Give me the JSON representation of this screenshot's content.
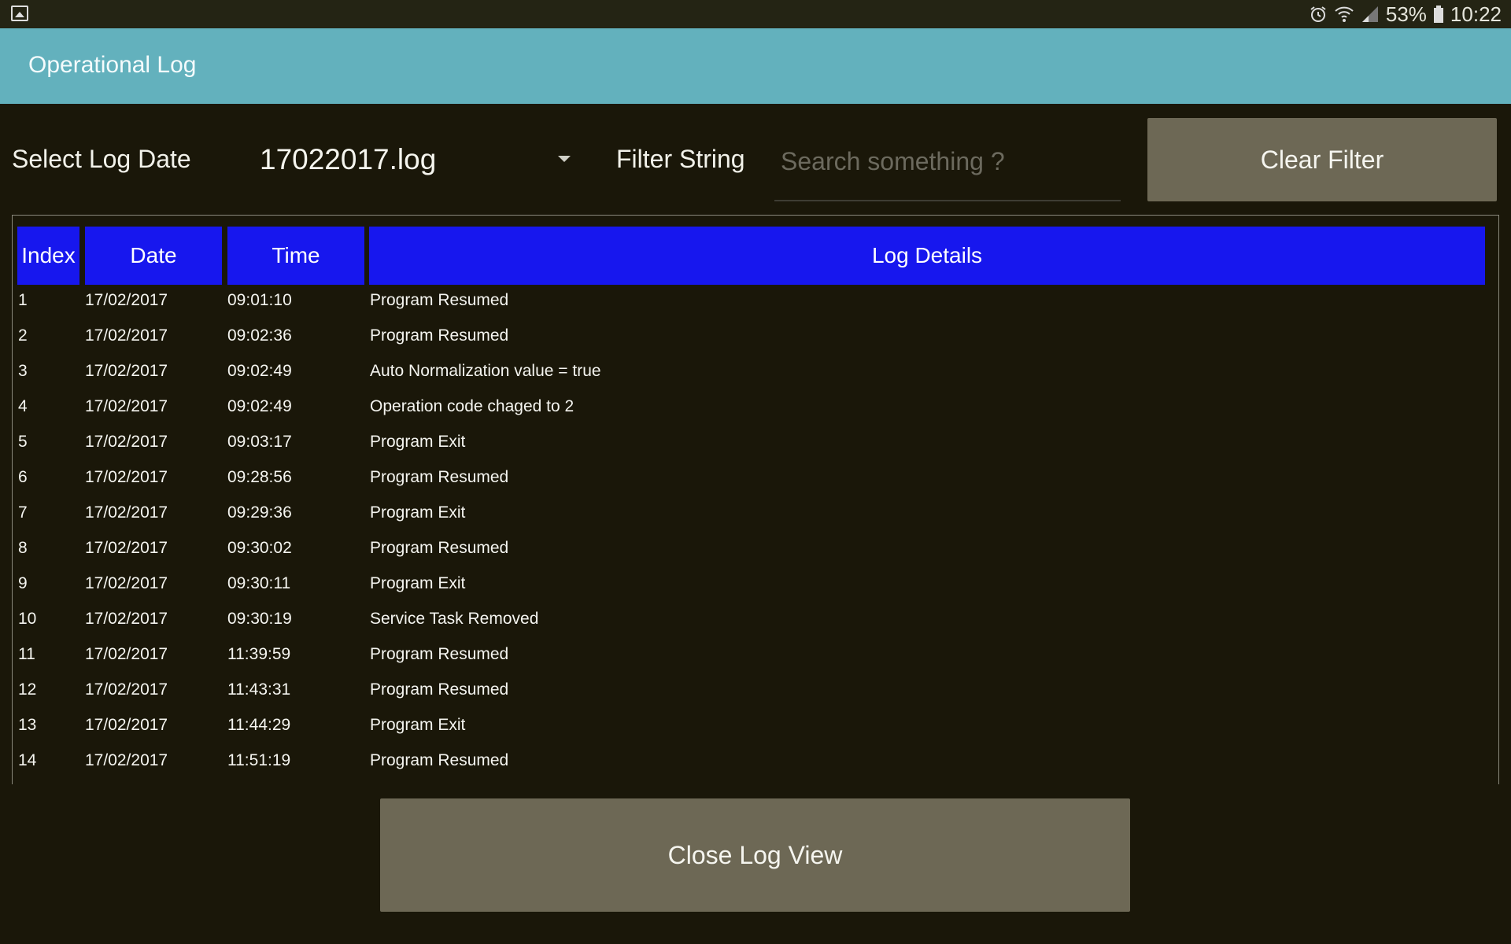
{
  "status_bar": {
    "left_icon": "gallery-icon",
    "icons": [
      "alarm-icon",
      "wifi-icon",
      "signal-icon"
    ],
    "battery_percent": "53%",
    "time": "10:22"
  },
  "app_bar": {
    "title": "Operational Log"
  },
  "controls": {
    "date_label": "Select Log Date",
    "date_selected": "17022017.log",
    "filter_label": "Filter String",
    "search_placeholder": "Search something ?",
    "search_value": "",
    "clear_button": "Clear Filter"
  },
  "table": {
    "headers": {
      "index": "Index",
      "date": "Date",
      "time": "Time",
      "details": "Log Details"
    },
    "rows": [
      {
        "index": "1",
        "date": "17/02/2017",
        "time": "09:01:10",
        "details": "Program Resumed"
      },
      {
        "index": "2",
        "date": "17/02/2017",
        "time": "09:02:36",
        "details": "Program Resumed"
      },
      {
        "index": "3",
        "date": "17/02/2017",
        "time": "09:02:49",
        "details": "Auto Normalization value = true"
      },
      {
        "index": "4",
        "date": "17/02/2017",
        "time": "09:02:49",
        "details": "Operation code chaged to 2"
      },
      {
        "index": "5",
        "date": "17/02/2017",
        "time": "09:03:17",
        "details": "Program Exit"
      },
      {
        "index": "6",
        "date": "17/02/2017",
        "time": "09:28:56",
        "details": "Program Resumed"
      },
      {
        "index": "7",
        "date": "17/02/2017",
        "time": "09:29:36",
        "details": "Program Exit"
      },
      {
        "index": "8",
        "date": "17/02/2017",
        "time": "09:30:02",
        "details": "Program Resumed"
      },
      {
        "index": "9",
        "date": "17/02/2017",
        "time": "09:30:11",
        "details": "Program Exit"
      },
      {
        "index": "10",
        "date": "17/02/2017",
        "time": "09:30:19",
        "details": "Service Task Removed"
      },
      {
        "index": "11",
        "date": "17/02/2017",
        "time": "11:39:59",
        "details": "Program Resumed"
      },
      {
        "index": "12",
        "date": "17/02/2017",
        "time": "11:43:31",
        "details": "Program Resumed"
      },
      {
        "index": "13",
        "date": "17/02/2017",
        "time": "11:44:29",
        "details": "Program Exit"
      },
      {
        "index": "14",
        "date": "17/02/2017",
        "time": "11:51:19",
        "details": "Program Resumed"
      }
    ]
  },
  "footer": {
    "close_button": "Close Log View"
  },
  "colors": {
    "background": "#1a1709",
    "app_bar": "#63b1bd",
    "header_blue": "#1717ee",
    "button": "#6d6855"
  }
}
